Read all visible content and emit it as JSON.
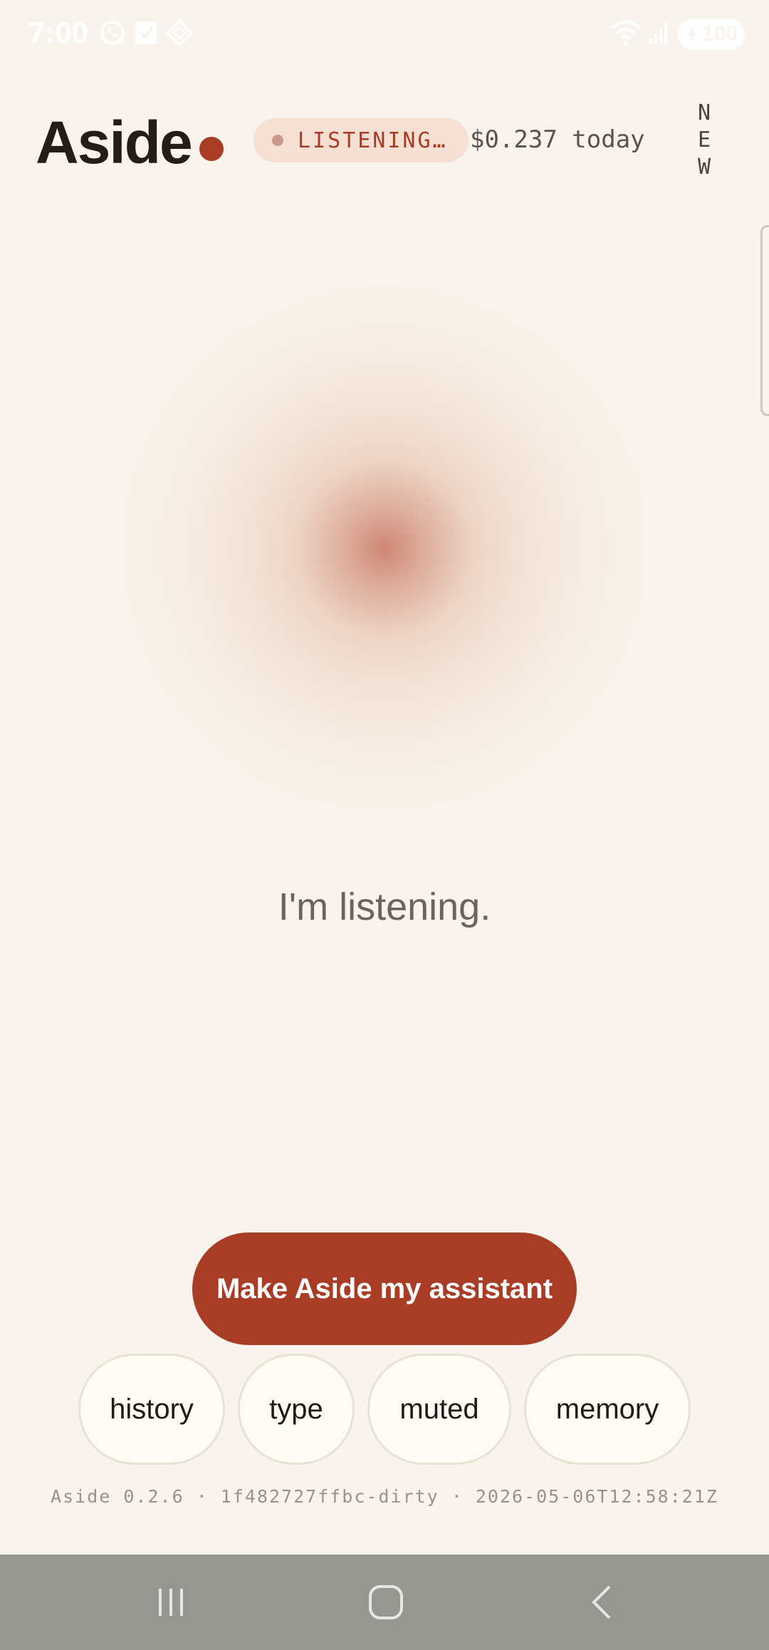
{
  "status_bar": {
    "time": "7:00",
    "battery": "100",
    "icons": [
      "whatsapp-icon",
      "task-icon",
      "app-diamond-icon",
      "wifi-icon",
      "signal-icon",
      "battery-icon"
    ]
  },
  "header": {
    "title": "Aside",
    "status_label": "LISTENING…",
    "cost": "$0.237 today",
    "new_letters": [
      "N",
      "E",
      "W"
    ]
  },
  "main": {
    "message": "I'm listening."
  },
  "actions": {
    "primary_label": "Make Aside my assistant",
    "chips": [
      "history",
      "type",
      "muted",
      "memory"
    ]
  },
  "footer": {
    "version": "Aside 0.2.6 · 1f482727ffbc-dirty · 2026-05-06T12:58:21Z"
  },
  "nav": {
    "icons": [
      "recent-apps-icon",
      "home-icon",
      "back-icon"
    ]
  },
  "colors": {
    "background": "#f8f4ed",
    "accent": "#a83c25",
    "pill_bg": "#f6dfd3",
    "chip_bg": "#fdfbf4",
    "nav_bg": "#979792"
  }
}
